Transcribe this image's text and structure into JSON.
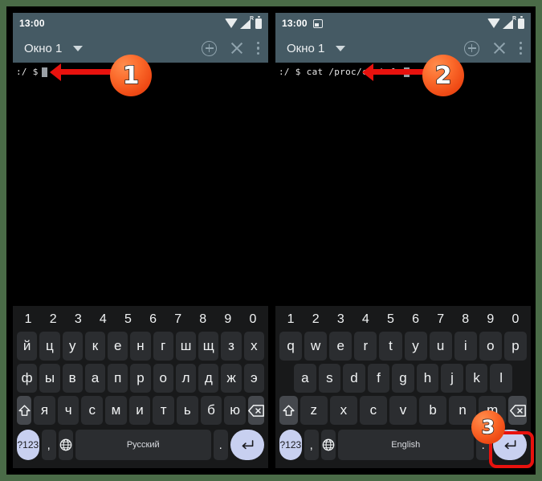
{
  "theme": {
    "outer_border": "#4a6b47",
    "toolbar_bg": "#455a64",
    "terminal_bg": "#000000",
    "keyboard_bg": "#18191a",
    "key_bg": "#2b2d30",
    "accent_key_bg": "#c8d0f0",
    "annotation_red": "#e8120e",
    "badge_orange": "#f4601f"
  },
  "left_panel": {
    "status": {
      "clock": "13:00",
      "icons": [
        "wifi-icon",
        "signal-icon",
        "battery-icon"
      ],
      "roaming_label": "R"
    },
    "toolbar": {
      "window_title": "Окно 1",
      "dropdown_icon": "chevron-down-icon",
      "actions": [
        "add-tab-icon",
        "close-icon",
        "overflow-menu-icon"
      ]
    },
    "terminal": {
      "prompt": ":/ $",
      "command": "",
      "cursor": true
    },
    "keyboard": {
      "language_label": "Русский",
      "numbers": [
        "1",
        "2",
        "3",
        "4",
        "5",
        "6",
        "7",
        "8",
        "9",
        "0"
      ],
      "row1": [
        "й",
        "ц",
        "у",
        "к",
        "е",
        "н",
        "г",
        "ш",
        "щ",
        "з",
        "х"
      ],
      "row2": [
        "ф",
        "ы",
        "в",
        "а",
        "п",
        "р",
        "о",
        "л",
        "д",
        "ж",
        "э"
      ],
      "row3": [
        "я",
        "ч",
        "с",
        "м",
        "и",
        "т",
        "ь",
        "б",
        "ю"
      ],
      "shift_label": "shift-icon",
      "backspace_label": "backspace-icon",
      "symbols_label": "?123",
      "comma_label": ",",
      "globe_label": "globe-icon",
      "period_label": ".",
      "enter_label": "enter-icon"
    }
  },
  "right_panel": {
    "status": {
      "clock": "13:00",
      "screenshot_icon": "screenshot-icon",
      "icons": [
        "wifi-icon",
        "signal-icon",
        "battery-icon"
      ],
      "roaming_label": "R"
    },
    "toolbar": {
      "window_title": "Окно 1",
      "dropdown_icon": "chevron-down-icon",
      "actions": [
        "add-tab-icon",
        "close-icon",
        "overflow-menu-icon"
      ]
    },
    "terminal": {
      "prompt": ":/ $",
      "command": "cat /proc/cpuinfo",
      "cursor": true
    },
    "keyboard": {
      "language_label": "English",
      "numbers": [
        "1",
        "2",
        "3",
        "4",
        "5",
        "6",
        "7",
        "8",
        "9",
        "0"
      ],
      "row1": [
        "q",
        "w",
        "e",
        "r",
        "t",
        "y",
        "u",
        "i",
        "o",
        "p"
      ],
      "row2": [
        "a",
        "s",
        "d",
        "f",
        "g",
        "h",
        "j",
        "k",
        "l"
      ],
      "row3": [
        "z",
        "x",
        "c",
        "v",
        "b",
        "n",
        "m"
      ],
      "shift_label": "shift-icon",
      "backspace_label": "backspace-icon",
      "symbols_label": "?123",
      "comma_label": ",",
      "globe_label": "globe-icon",
      "period_label": ".",
      "enter_label": "enter-icon"
    }
  },
  "annotations": {
    "badge1": "1",
    "badge2": "2",
    "badge3": "3"
  }
}
